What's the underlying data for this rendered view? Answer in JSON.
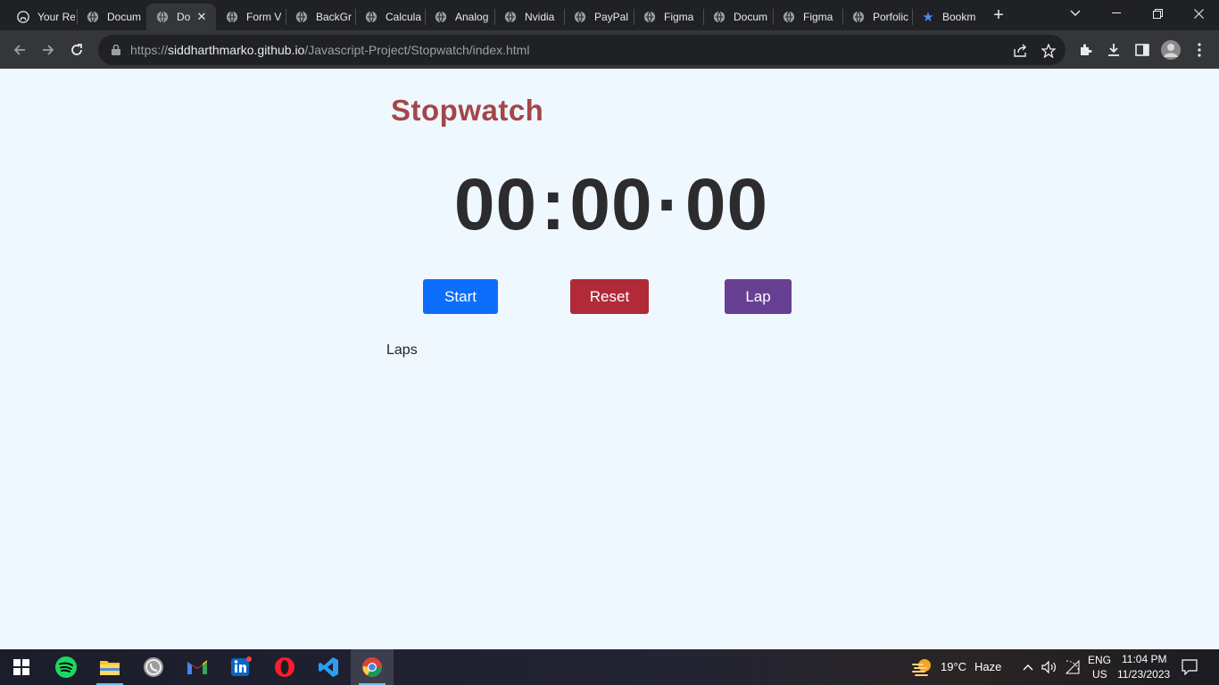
{
  "browser": {
    "tabs": [
      {
        "title": "Your Re",
        "icon": "github-icon"
      },
      {
        "title": "Docum",
        "icon": "globe-icon"
      },
      {
        "title": "Do",
        "icon": "globe-icon",
        "active": true
      },
      {
        "title": "Form V",
        "icon": "globe-icon"
      },
      {
        "title": "BackGr",
        "icon": "globe-icon"
      },
      {
        "title": "Calcula",
        "icon": "globe-icon"
      },
      {
        "title": "Analog",
        "icon": "globe-icon"
      },
      {
        "title": "Nvidia",
        "icon": "globe-icon"
      },
      {
        "title": "PayPal",
        "icon": "globe-icon"
      },
      {
        "title": "Figma",
        "icon": "globe-icon"
      },
      {
        "title": "Docum",
        "icon": "globe-icon"
      },
      {
        "title": "Figma",
        "icon": "globe-icon"
      },
      {
        "title": "Porfolic",
        "icon": "globe-icon"
      },
      {
        "title": "Bookm",
        "icon": "star-icon"
      }
    ],
    "url_prefix": "https://",
    "url_host": "siddharthmarko.github.io",
    "url_path": "/Javascript-Project/Stopwatch/index.html"
  },
  "page": {
    "heading": "Stopwatch",
    "display": {
      "minutes": "00",
      "seconds": "00",
      "centiseconds": "00"
    },
    "buttons": {
      "start": "Start",
      "reset": "Reset",
      "lap": "Lap"
    },
    "laps_label": "Laps"
  },
  "colors": {
    "heading": "#a4464a",
    "start": "#0d6efd",
    "reset": "#b02a37",
    "lap": "#673f93",
    "page_bg": "#f0f8ff"
  },
  "taskbar": {
    "apps": [
      "windows-start-icon",
      "spotify-icon",
      "file-explorer-icon",
      "whatsapp-icon",
      "gmail-icon",
      "linkedin-icon",
      "opera-icon",
      "vscode-icon",
      "chrome-icon"
    ],
    "weather_temp": "19°C",
    "weather_desc": "Haze",
    "lang_line1": "ENG",
    "lang_line2": "US",
    "time": "11:04 PM",
    "date": "11/23/2023"
  }
}
